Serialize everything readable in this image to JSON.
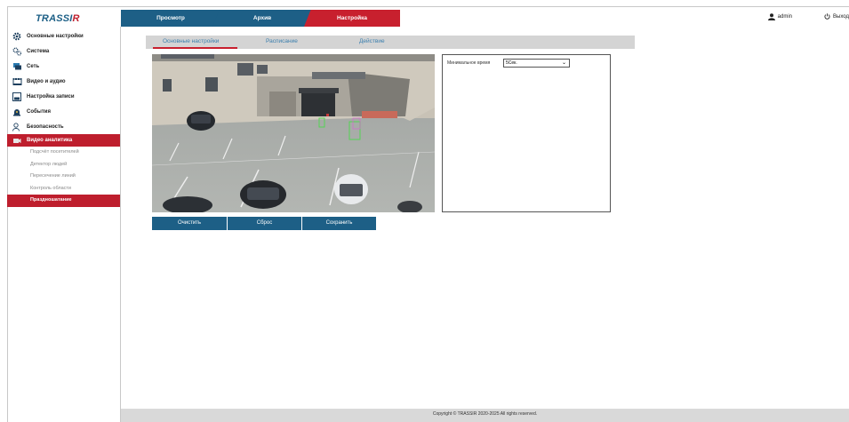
{
  "header": {
    "logo": "TRASSIR",
    "tabs": [
      {
        "label": "Просмотр"
      },
      {
        "label": "Архив"
      },
      {
        "label": "Настройка"
      }
    ],
    "user": "admin",
    "logout": "Выход"
  },
  "sidebar": {
    "items": [
      {
        "label": "Основные настройки",
        "icon": "gear-icon"
      },
      {
        "label": "Система",
        "icon": "gears-icon"
      },
      {
        "label": "Сеть",
        "icon": "network-icon"
      },
      {
        "label": "Видео и аудио",
        "icon": "film-icon"
      },
      {
        "label": "Настройка записи",
        "icon": "disk-icon"
      },
      {
        "label": "События",
        "icon": "alarm-icon"
      },
      {
        "label": "Безопасность",
        "icon": "user-shield-icon"
      },
      {
        "label": "Видео аналитика",
        "icon": "analytics-icon"
      }
    ],
    "subitems": [
      {
        "label": "Подсчёт посетителей"
      },
      {
        "label": "Детектор людей"
      },
      {
        "label": "Пересечение линий"
      },
      {
        "label": "Контроль области"
      },
      {
        "label": "Праздношатание"
      }
    ]
  },
  "main": {
    "subtabs": [
      {
        "label": "Основные настройки"
      },
      {
        "label": "Расписание"
      },
      {
        "label": "Действие"
      }
    ],
    "option_label": "Минимальное время",
    "option_value": "5Сек.",
    "buttons": {
      "clear": "Очистить",
      "reset": "Сброс",
      "save": "Сохранить"
    }
  },
  "footer": "Copyright © TRASSIR 2020-2025 All rights reserved.",
  "colors": {
    "accent_blue": "#1d5f86",
    "accent_red": "#c8202e"
  }
}
